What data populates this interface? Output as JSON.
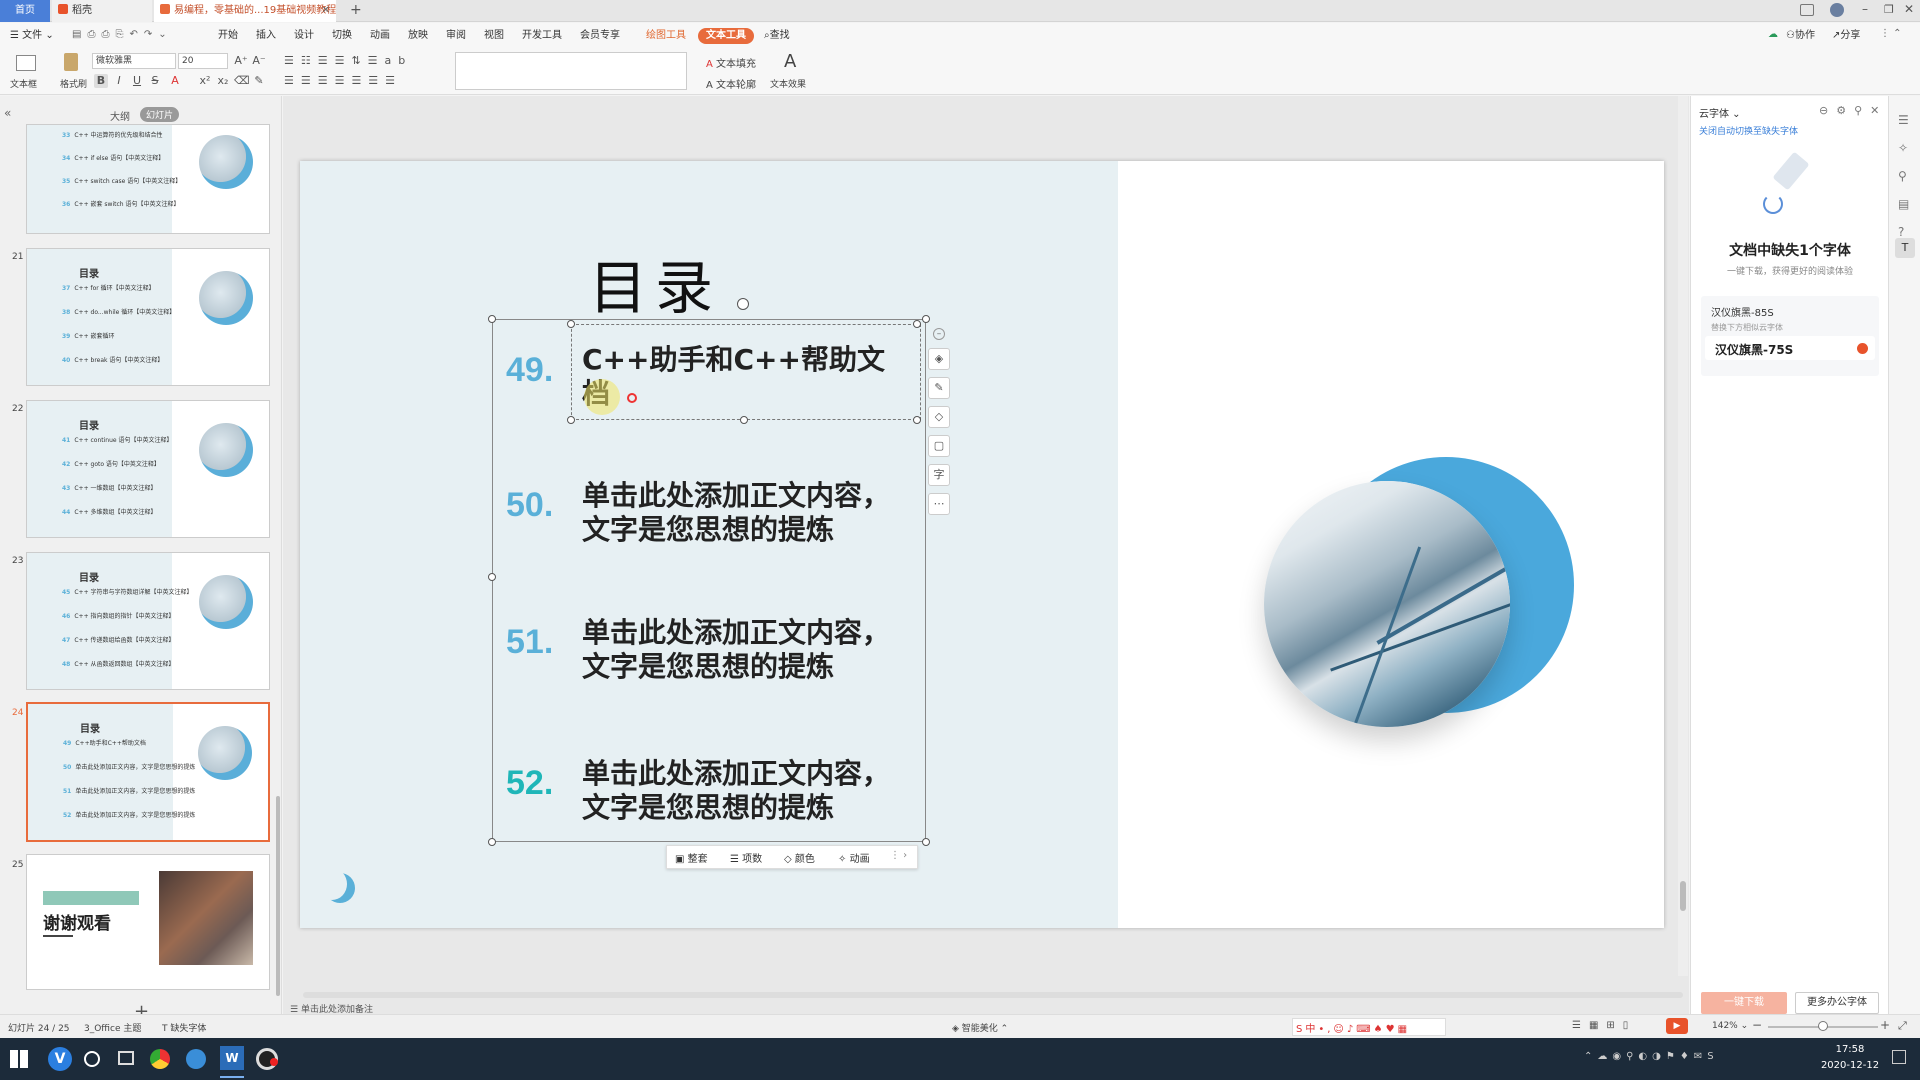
{
  "tabs": {
    "home": "首页",
    "t2": "稻壳",
    "t3": "易编程，零基础的...19基础视频教程"
  },
  "menu": {
    "file": "文件",
    "items": [
      "开始",
      "插入",
      "设计",
      "切换",
      "动画",
      "放映",
      "审阅",
      "视图",
      "开发工具",
      "会员专享"
    ],
    "draw_tools": "绘图工具",
    "text_tools": "文本工具",
    "search": "查找",
    "collab": "协作",
    "share": "分享"
  },
  "toolbar": {
    "textbox": "文本框",
    "format_painter": "格式刷",
    "font_name": "微软雅黑",
    "font_size": "20",
    "text_fill": "文本填充",
    "text_outline": "文本轮廓",
    "text_effect": "文本效果",
    "bold": "B",
    "italic": "I",
    "underline": "U",
    "strike": "S"
  },
  "styles": {
    "colors": [
      "#111111",
      "#4aa3df",
      "#30c0d8",
      "#f3b08a",
      "#f1b33c",
      "#555555"
    ],
    "glyph": "A"
  },
  "left_panel": {
    "outline_tab": "大纲",
    "slides_tab": "幻灯片",
    "add_slide": "+"
  },
  "thumbnails": [
    {
      "num": "",
      "title": "",
      "items": [
        {
          "n": "33",
          "t": "C++ 中运算符的优先级和结合性"
        },
        {
          "n": "34",
          "t": "C++ if else 语句【中英文注释】"
        },
        {
          "n": "35",
          "t": "C++ switch case 语句【中英文注释】"
        },
        {
          "n": "36",
          "t": "C++ 嵌套 switch 语句【中英文注释】"
        }
      ]
    },
    {
      "num": "21",
      "title": "目录",
      "items": [
        {
          "n": "37",
          "t": "C++ for 循环【中英文注释】"
        },
        {
          "n": "38",
          "t": "C++ do...while 循环【中英文注释】"
        },
        {
          "n": "39",
          "t": "C++ 嵌套循环"
        },
        {
          "n": "40",
          "t": "C++ break 语句【中英文注释】"
        }
      ]
    },
    {
      "num": "22",
      "title": "目录",
      "items": [
        {
          "n": "41",
          "t": "C++ continue 语句【中英文注释】"
        },
        {
          "n": "42",
          "t": "C++ goto 语句【中英文注释】"
        },
        {
          "n": "43",
          "t": "C++ 一维数组【中英文注释】"
        },
        {
          "n": "44",
          "t": "C++ 多维数组【中英文注释】"
        }
      ]
    },
    {
      "num": "23",
      "title": "目录",
      "items": [
        {
          "n": "45",
          "t": "C++ 字符串与字符数组详解【中英文注释】"
        },
        {
          "n": "46",
          "t": "C++ 指向数组的指针【中英文注释】"
        },
        {
          "n": "47",
          "t": "C++ 传递数组给函数【中英文注释】"
        },
        {
          "n": "48",
          "t": "C++ 从函数返回数组【中英文注释】"
        }
      ]
    },
    {
      "num": "24",
      "title": "目录",
      "items": [
        {
          "n": "49",
          "t": "C++助手和C++帮助文档"
        },
        {
          "n": "50",
          "t": "单击此处添加正文内容，文字是您思想的提炼"
        },
        {
          "n": "51",
          "t": "单击此处添加正文内容，文字是您思想的提炼"
        },
        {
          "n": "52",
          "t": "单击此处添加正文内容，文字是您思想的提炼"
        }
      ]
    },
    {
      "num": "25",
      "title": "谢谢观看",
      "items": []
    }
  ],
  "slide": {
    "title": "目录",
    "entries": [
      {
        "num": "49.",
        "line1": "C++助手和C++帮助文",
        "line2": "档"
      },
      {
        "num": "50.",
        "line1": "单击此处添加正文内容，",
        "line2": "文字是您思想的提炼"
      },
      {
        "num": "51.",
        "line1": "单击此处添加正文内容，",
        "line2": "文字是您思想的提炼"
      },
      {
        "num": "52.",
        "line1": "单击此处添加正文内容，",
        "line2": "文字是您思想的提炼"
      }
    ],
    "float_bar": [
      "整套",
      "项数",
      "颜色",
      "动画"
    ]
  },
  "right_panel": {
    "title": "云字体",
    "link": "关闭自动切换至缺失字体",
    "headline": "文档中缺失1个字体",
    "sub": "一键下载，获得更好的阅读体验",
    "missing_font": "汉仪旗黑-85S",
    "replace_hint": "替换下方相似云字体",
    "replacement": "汉仪旗黑-75S",
    "download": "一键下载",
    "more": "更多办公字体"
  },
  "status": {
    "slide_count": "幻灯片 24 / 25",
    "theme": "3_Office 主题",
    "missing_font": "缺失字体",
    "beautify": "智能美化",
    "notes": "单击此处添加备注",
    "zoom": "142%"
  },
  "taskbar": {
    "time": "17:58",
    "date": "2020-12-12"
  }
}
